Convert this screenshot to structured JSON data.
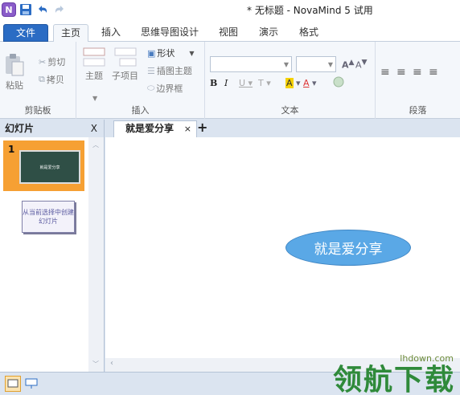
{
  "window": {
    "title": "* 无标题 - NovaMind 5 试用",
    "app_icon_letter": "N"
  },
  "tabs": [
    {
      "label": "文件"
    },
    {
      "label": "主页"
    },
    {
      "label": "插入"
    },
    {
      "label": "思维导图设计"
    },
    {
      "label": "视图"
    },
    {
      "label": "演示"
    },
    {
      "label": "格式"
    }
  ],
  "ribbon": {
    "clipboard": {
      "label": "剪贴板",
      "paste": "粘贴",
      "cut": "剪切",
      "copy": "拷贝"
    },
    "insert": {
      "label": "插入",
      "topic": "主题",
      "subtopic": "子项目",
      "shape": "形状",
      "callout": "插图主题",
      "boundary": "边界框"
    },
    "text": {
      "label": "文本",
      "font_value": "",
      "size_value": ""
    },
    "paragraph": {
      "label": "段落"
    }
  },
  "slides_pane": {
    "title": "幻灯片",
    "close": "X",
    "slide_number": "1",
    "slide_thumb_text": "就是爱分享",
    "new_slide_text": "从当前选择中创建幻灯片"
  },
  "doc": {
    "tab_label": "就是爱分享",
    "tab_close": "×",
    "add_tab": "+"
  },
  "canvas": {
    "central_node": "就是爱分享"
  },
  "watermark": {
    "site": "lhdown.com",
    "text": "领航下载"
  },
  "colors": {
    "accent": "#2b6cc4",
    "node_fill": "#5aa8e6",
    "slide_selected": "#f6a033",
    "thumb_bg": "#2f4f46"
  }
}
